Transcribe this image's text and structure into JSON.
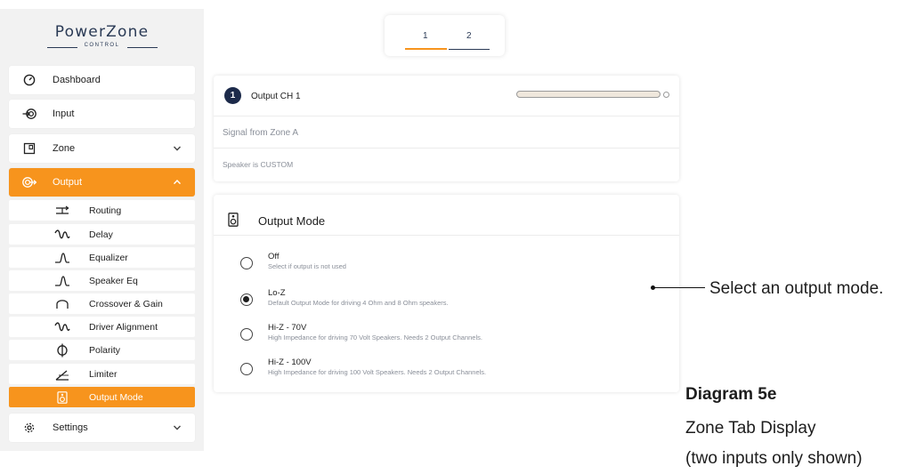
{
  "brand": {
    "name": "PowerZone",
    "sub": "CONTROL"
  },
  "nav": {
    "items": [
      {
        "label": "Dashboard",
        "icon": "gauge-icon"
      },
      {
        "label": "Input",
        "icon": "input-icon"
      },
      {
        "label": "Zone",
        "icon": "zone-icon"
      },
      {
        "label": "Output",
        "icon": "output-icon",
        "active": true
      },
      {
        "label": "Settings",
        "icon": "gear-icon"
      }
    ],
    "sub_items": [
      {
        "label": "Routing",
        "icon": "routing-icon"
      },
      {
        "label": "Delay",
        "icon": "delay-icon"
      },
      {
        "label": "Equalizer",
        "icon": "equalizer-icon"
      },
      {
        "label": "Speaker Eq",
        "icon": "speaker-eq-icon"
      },
      {
        "label": "Crossover & Gain",
        "icon": "crossover-icon"
      },
      {
        "label": "Driver Alignment",
        "icon": "driver-alignment-icon"
      },
      {
        "label": "Polarity",
        "icon": "polarity-icon"
      },
      {
        "label": "Limiter",
        "icon": "limiter-icon"
      },
      {
        "label": "Output Mode",
        "icon": "speaker-icon",
        "active": true
      }
    ]
  },
  "tabs": [
    {
      "label": "1",
      "active": true
    },
    {
      "label": "2",
      "active": false
    }
  ],
  "channel": {
    "number": "1",
    "title": "Output CH 1",
    "signal": "Signal from Zone A",
    "speaker": "Speaker is CUSTOM"
  },
  "output_mode": {
    "title": "Output Mode",
    "selected": "Lo-Z",
    "options": [
      {
        "label": "Off",
        "description": "Select if output is not used"
      },
      {
        "label": "Lo-Z",
        "description": "Default Output Mode for driving 4 Ohm and 8 Ohm speakers."
      },
      {
        "label": "Hi-Z - 70V",
        "description": "High Impedance for driving 70 Volt Speakers. Needs 2 Output Channels."
      },
      {
        "label": "Hi-Z - 100V",
        "description": "High Impedance for driving 100 Volt Speakers. Needs 2 Output Channels."
      }
    ]
  },
  "annotation": {
    "callout": "Select an output mode.",
    "caption_title": "Diagram 5e",
    "caption_line1": "Zone Tab Display",
    "caption_line2": "(two inputs only shown)"
  },
  "colors": {
    "accent": "#f7941d",
    "navy": "#1c2a4a",
    "sidebar_bg": "#f2f2f2",
    "tab_underline_active": "#f7941d",
    "tab_underline_inactive": "#2a3a55"
  }
}
